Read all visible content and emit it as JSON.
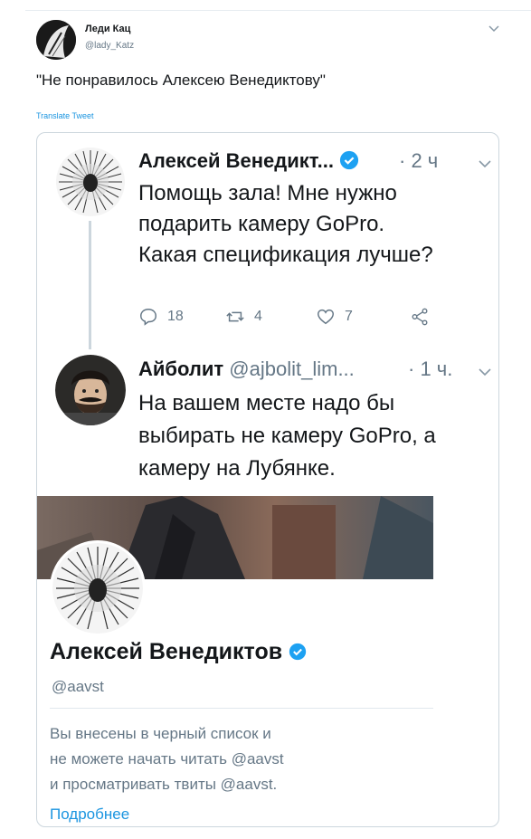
{
  "outer_tweet": {
    "author_name": "Леди Кац",
    "author_handle": "@lady_Katz",
    "text": "\"Не понравилось Алексею Венедиктову\"",
    "translate_label": "Translate Tweet"
  },
  "embedded": {
    "tweet1": {
      "author_name": "Алексей Венедикт...",
      "time": "· 2 ч",
      "body_lines": [
        "Помощь зала! Мне нужно",
        "подарить камеру GoPro.",
        "Какая спецификация лучше?"
      ],
      "reply_count": "18",
      "retweet_count": "4",
      "like_count": "7"
    },
    "tweet2": {
      "author_name": "Айболит",
      "author_handle": "@ajbolit_lim...",
      "time": "· 1 ч.",
      "body_lines": [
        "На вашем месте надо бы",
        "выбирать не камеру GoPro, а",
        "камеру на Лубянке."
      ]
    },
    "profile": {
      "name": "Алексей Венедиктов",
      "handle": "@aavst",
      "blocked_lines": [
        "Вы внесены в черный список и",
        "не можете начать читать @aavst",
        "и просматривать твиты @aavst."
      ],
      "more_link": "Подробнее"
    }
  },
  "colors": {
    "accent": "#1b95e0",
    "verified": "#1da1f2",
    "muted": "#657786",
    "text": "#14171a"
  },
  "icons": [
    "chevron-down-icon",
    "verified-badge-icon",
    "reply-icon",
    "retweet-icon",
    "like-icon",
    "share-icon"
  ]
}
